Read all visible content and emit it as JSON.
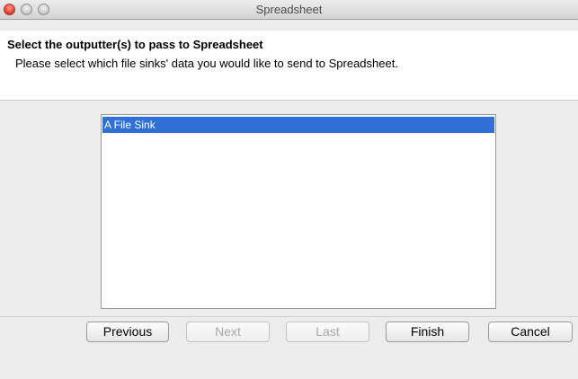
{
  "window": {
    "title": "Spreadsheet"
  },
  "header": {
    "title": "Select the outputter(s) to pass to Spreadsheet",
    "description": "Please select which file sinks' data you would like to send to Spreadsheet."
  },
  "list": {
    "items": [
      {
        "label": "A File Sink",
        "selected": true
      }
    ],
    "selection_color": "#2f6fd6"
  },
  "buttons": {
    "previous": {
      "label": "Previous",
      "enabled": true
    },
    "next": {
      "label": "Next",
      "enabled": false
    },
    "last": {
      "label": "Last",
      "enabled": false
    },
    "finish": {
      "label": "Finish",
      "enabled": true
    },
    "cancel": {
      "label": "Cancel",
      "enabled": true
    }
  }
}
